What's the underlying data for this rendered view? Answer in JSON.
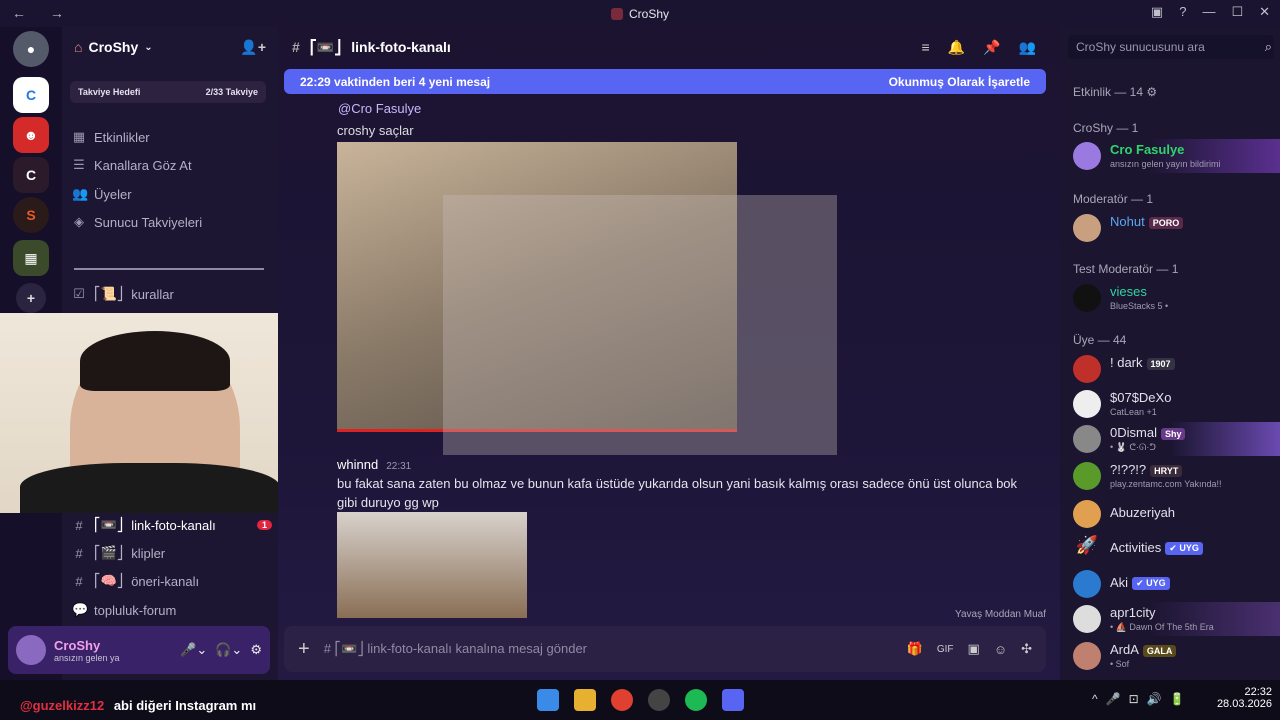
{
  "window": {
    "title": "CroShy"
  },
  "server": {
    "name": "CroShy",
    "boost_goal": "Takviye Hedefi",
    "boost_count": "2/33 Takviye",
    "peek_name": "! dark",
    "peek_badge": "1907"
  },
  "sidebar": {
    "items": [
      "Etkinlikler",
      "Kanallara Göz At",
      "Üyeler",
      "Sunucu Takviyeleri"
    ],
    "ch_rules": "kurallar",
    "ch_link": "link-foto-kanalı",
    "ch_link_badge": "1",
    "ch_clips": "klipler",
    "ch_suggest": "öneri-kanalı",
    "ch_forum": "topluluk-forum"
  },
  "user": {
    "name": "CroShy",
    "status": "ansızın gelen ya"
  },
  "channel": {
    "name": "link-foto-kanalı",
    "search_placeholder": "CroShy sunucusunu ara"
  },
  "newbar": {
    "text": "22:29 vaktinden beri 4 yeni mesaj",
    "action": "Okunmuş Olarak İşaretle"
  },
  "messages": {
    "m1_mention": "@Cro Fasulye",
    "m1_text": "croshy saçlar",
    "m2_author": "whinnd",
    "m2_time": "22:31",
    "m2_text": "bu fakat sana zaten bu olmaz ve bunun kafa üstüde yukarıda olsun yani basık kalmış orası sadece önü üst olunca bok gibi duruyo gg wp"
  },
  "slowmode": "Yavaş Moddan Muaf",
  "composer": {
    "placeholder": "# ⎡📼⎦ link-foto-kanalı kanalına mesaj gönder"
  },
  "members": {
    "activity_header": "Etkinlik — 14",
    "g_croshy": "CroShy — 1",
    "g_mod": "Moderatör — 1",
    "g_test": "Test Moderatör — 1",
    "g_uye": "Üye — 44",
    "list": [
      {
        "name": "Cro Fasulye",
        "status": "ansızın gelen yayın bildirimi",
        "color": "#2fd46b",
        "tag": ""
      },
      {
        "name": "Nohut",
        "status": "",
        "color": "#5aa8f0",
        "tag": "PORO"
      },
      {
        "name": "vieses",
        "status": "BlueStacks 5 •",
        "color": "#2fd4a0",
        "tag": ""
      },
      {
        "name": "! dark",
        "status": "",
        "color": "#e2e0ea",
        "tag": "1907"
      },
      {
        "name": "$07$DeXo",
        "status": "CatLean +1",
        "color": "#e2e0ea",
        "tag": ""
      },
      {
        "name": "0Dismal",
        "status": "• 🐰 ᕦ·ᘏ·ᕤ",
        "color": "#e2e0ea",
        "tag": "Shy"
      },
      {
        "name": "?!??!?",
        "status": "play.zentamc.com Yakında!!",
        "color": "#e2e0ea",
        "tag": "HRYT"
      },
      {
        "name": "Abuzeriyah",
        "status": "",
        "color": "#e2e0ea",
        "tag": ""
      },
      {
        "name": "Activities",
        "status": "",
        "color": "#e2e0ea",
        "tag": "✔ UYG"
      },
      {
        "name": "Aki",
        "status": "",
        "color": "#e2e0ea",
        "tag": "✔ UYG"
      },
      {
        "name": "apr1city",
        "status": "• ⛵ Dawn Of The 5th Era",
        "color": "#e2e0ea",
        "tag": ""
      },
      {
        "name": "ArdA",
        "status": "• Sof",
        "color": "#e2e0ea",
        "tag": "GALA"
      }
    ]
  },
  "overlay": {
    "handle": "@guzelkizz12",
    "text": "abi diğeri Instagram mı"
  },
  "clock": {
    "time": "22:32",
    "date": "28.03.2026"
  },
  "colors": {
    "accent": "#5865f2",
    "brand": "#8a5cf6"
  }
}
